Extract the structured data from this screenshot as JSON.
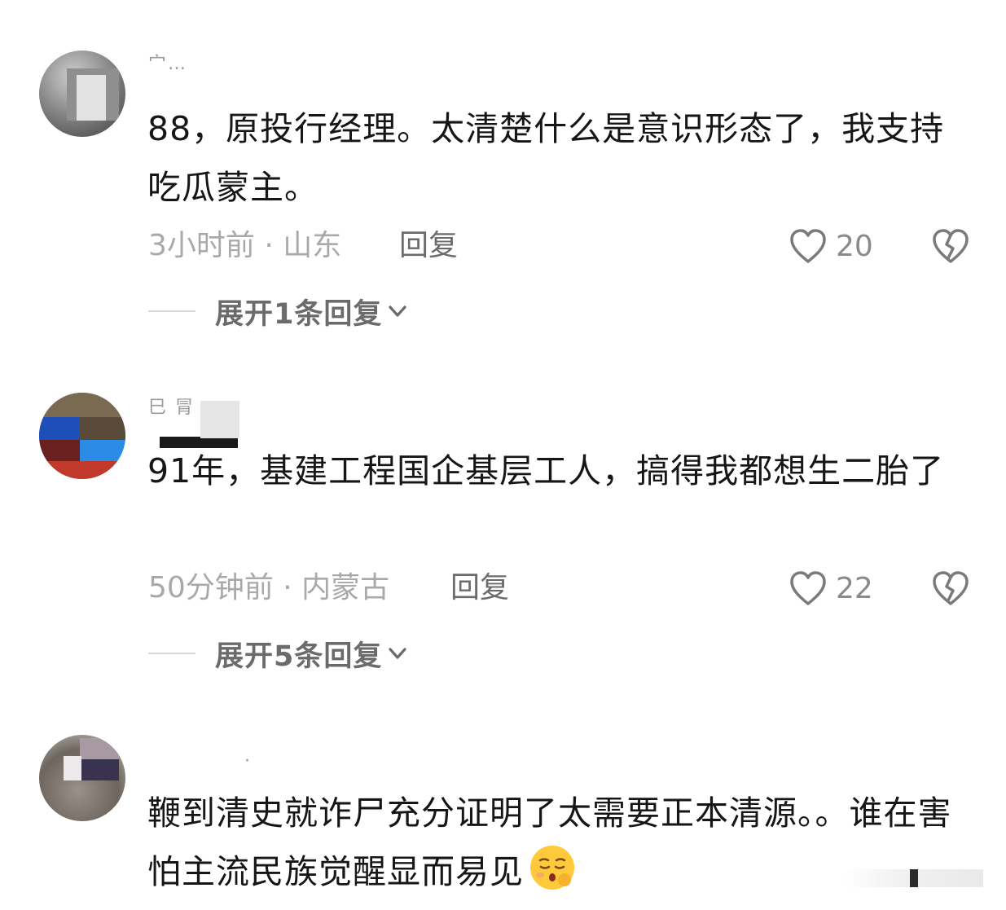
{
  "comments": [
    {
      "username": "宀…",
      "text": "88，原投行经理。太清楚什么是意识形态了，我支持吃瓜蒙主。",
      "meta": "3小时前 · 山东",
      "reply_label": "回复",
      "likes": "20",
      "expand_label": "展开1条回复"
    },
    {
      "username": "巳 冐 ‥",
      "text": "91年，基建工程国企基层工人，搞得我都想生二胎了",
      "meta": "50分钟前 · 内蒙古",
      "reply_label": "回复",
      "likes": "22",
      "expand_label": "展开5条回复"
    },
    {
      "username": "·",
      "text": "鞭到清史就诈尸充分证明了太需要正本清源。。谁在害怕主流民族觉醒显而易见",
      "emoji": "pleading-face-emoji"
    }
  ],
  "icons": {
    "like": "heart-outline-icon",
    "dislike": "broken-heart-icon",
    "expand": "chevron-down-icon"
  },
  "colors": {
    "text": "#161616",
    "meta": "#a9a9a9",
    "action": "#6b6b6b",
    "icon": "#7a7a7a"
  }
}
